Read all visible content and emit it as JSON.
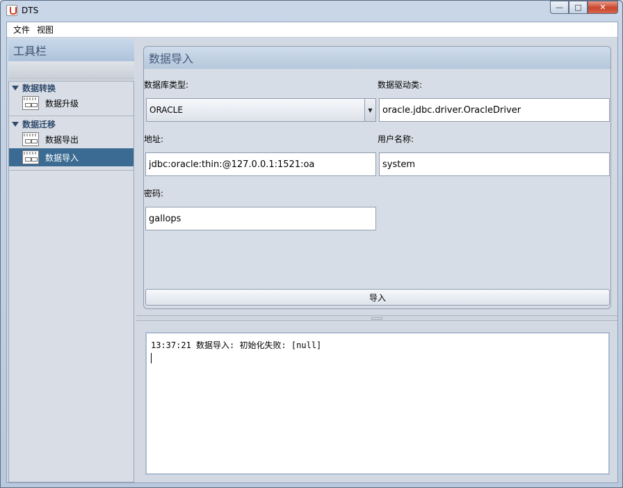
{
  "window": {
    "title": "DTS",
    "minimize": "—",
    "maximize": "□",
    "close": "✕"
  },
  "menubar": {
    "items": [
      "文件",
      "视图"
    ]
  },
  "toolbar": {
    "title": "工具栏",
    "groups": [
      {
        "label": "数据转换",
        "items": [
          "数据升级"
        ]
      },
      {
        "label": "数据迁移",
        "items": [
          "数据导出",
          "数据导入"
        ]
      }
    ],
    "selected": "数据导入"
  },
  "import_panel": {
    "title": "数据导入",
    "db_type_label": "数据库类型:",
    "db_type_value": "ORACLE",
    "driver_label": "数据驱动类:",
    "driver_value": "oracle.jdbc.driver.OracleDriver",
    "address_label": "地址:",
    "address_value": "jdbc:oracle:thin:@127.0.0.1:1521:oa",
    "username_label": "用户名称:",
    "username_value": "system",
    "password_label": "密码:",
    "password_value": "gallops",
    "import_button": "导入"
  },
  "log": {
    "text": "13:37:21 数据导入: 初始化失败: [null]"
  }
}
